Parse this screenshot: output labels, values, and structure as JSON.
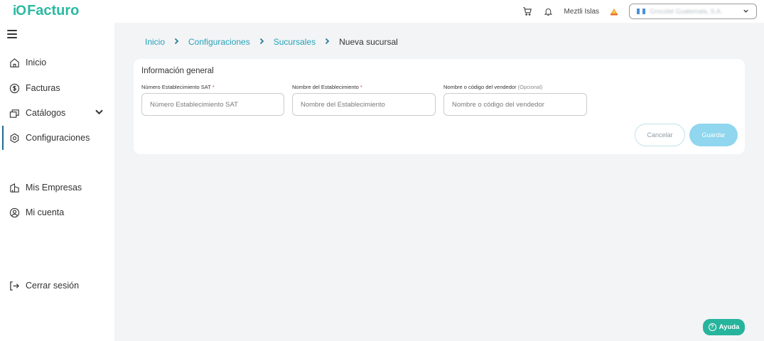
{
  "brand": {
    "logo_mark": "iO",
    "logo_text": "Facturo",
    "color": "#2bb9a2"
  },
  "header": {
    "user_name": "Meztli Islas",
    "company_name": "Grocolet Guatemala, S.A.",
    "icons": [
      "cart-icon",
      "bell-icon",
      "user-avatar-icon",
      "chevron-down-icon"
    ]
  },
  "sidebar": {
    "items": [
      {
        "label": "Inicio",
        "icon": "home-icon"
      },
      {
        "label": "Facturas",
        "icon": "dollar-icon"
      },
      {
        "label": "Catálogos",
        "icon": "catalog-icon"
      },
      {
        "label": "Configuraciones",
        "icon": "settings-icon",
        "active": true
      },
      {
        "label": "Mis Empresas",
        "icon": "building-icon"
      },
      {
        "label": "Mi cuenta",
        "icon": "account-icon"
      }
    ],
    "logout_label": "Cerrar sesión"
  },
  "breadcrumb": {
    "items": [
      "Inicio",
      "Configuraciones",
      "Sucursales",
      "Nueva sucursal"
    ],
    "separator": ">"
  },
  "form": {
    "title": "Información general",
    "fields": [
      {
        "label": "Número Establecimiento SAT",
        "required": "*",
        "placeholder": "Número Establecimiento SAT",
        "value": ""
      },
      {
        "label": "Nombre del Establecimiento",
        "required": "*",
        "placeholder": "Nombre del Establecimiento",
        "value": ""
      },
      {
        "label": "Nombre o código del vendedor",
        "optional": "(Opcional)",
        "placeholder": "Nombre o código del vendedor",
        "value": ""
      }
    ],
    "cancel_label": "Cancelar",
    "save_label": "Guardar"
  },
  "help": {
    "label": "Ayuda",
    "glyph": "?"
  },
  "colors": {
    "accent": "#25a2b8",
    "primary": "#27b49c",
    "save_disabled": "#8fd6ee",
    "required": "#e0443b",
    "active_bar": "#1d6b91"
  }
}
